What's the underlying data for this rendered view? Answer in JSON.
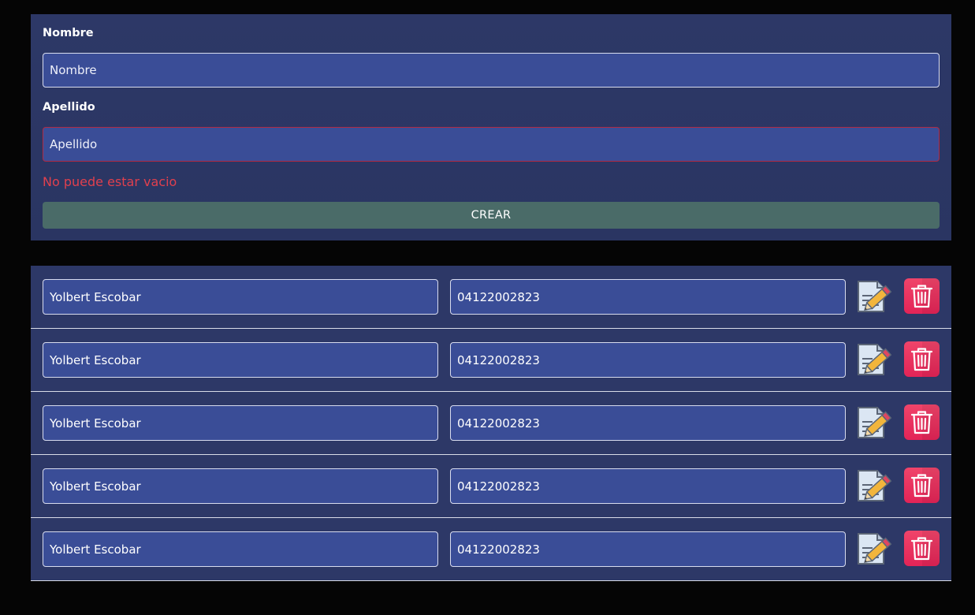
{
  "form": {
    "nombre_label": "Nombre",
    "nombre_placeholder": "Nombre",
    "apellido_label": "Apellido",
    "apellido_placeholder": "Apellido",
    "error_message": "No puede estar vacio",
    "create_label": "CREAR"
  },
  "contacts": [
    {
      "name": "Yolbert Escobar",
      "phone": "04122002823"
    },
    {
      "name": "Yolbert Escobar",
      "phone": "04122002823"
    },
    {
      "name": "Yolbert Escobar",
      "phone": "04122002823"
    },
    {
      "name": "Yolbert Escobar",
      "phone": "04122002823"
    },
    {
      "name": "Yolbert Escobar",
      "phone": "04122002823"
    }
  ],
  "icons": {
    "edit": "edit-icon",
    "delete": "trash-icon"
  },
  "colors": {
    "panel": "#2d3867",
    "input": "#3a4d97",
    "error": "#e0404e",
    "create_button": "#4a6b68",
    "delete_button": "#e8305e"
  }
}
